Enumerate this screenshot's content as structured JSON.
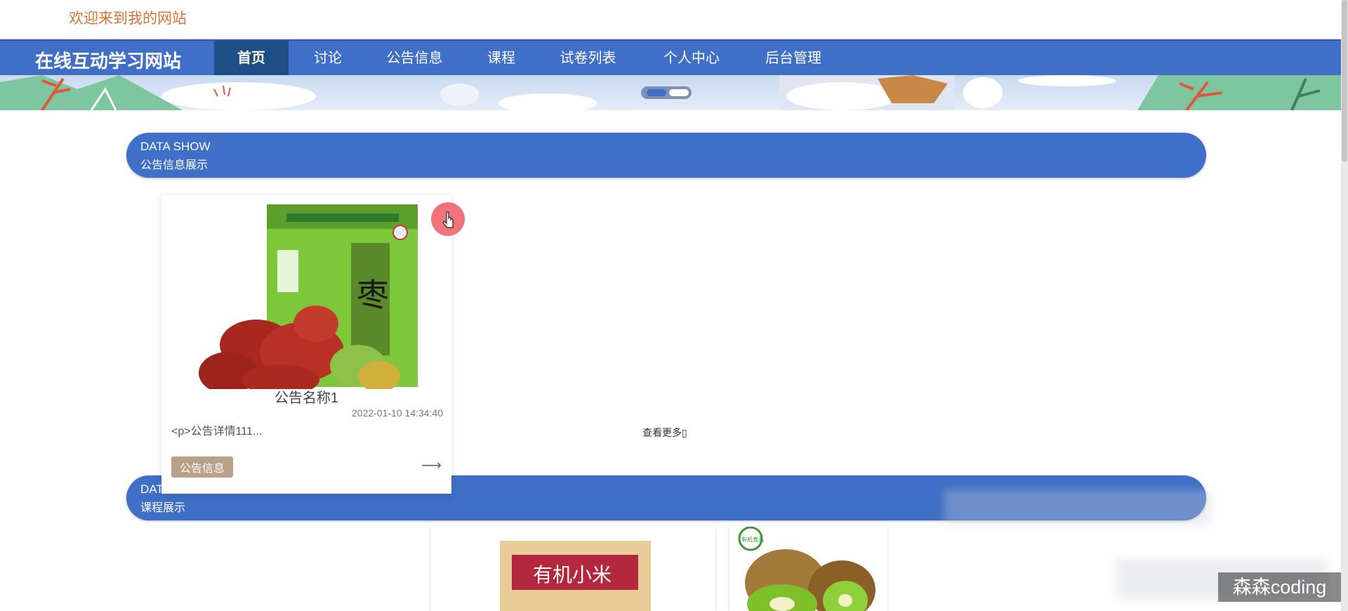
{
  "header": {
    "welcome": "欢迎来到我的网站"
  },
  "nav": {
    "site_title": "在线互动学习网站",
    "items": [
      {
        "label": "首页"
      },
      {
        "label": "讨论"
      },
      {
        "label": "公告信息"
      },
      {
        "label": "课程"
      },
      {
        "label": "试卷列表"
      },
      {
        "label": "个人中心"
      },
      {
        "label": "后台管理"
      }
    ],
    "active_index": 0
  },
  "banner": {
    "slide_count": 2,
    "active_slide": 1
  },
  "sections": [
    {
      "en": "DATA SHOW",
      "cn": "公告信息展示"
    },
    {
      "en": "DATA SHOW",
      "cn": "课程展示"
    }
  ],
  "notice_card": {
    "title": "公告名称1",
    "date": "2022-01-10 14:34:40",
    "desc": "<p>公告详情111...",
    "tag": "公告信息",
    "arrow": "⟶",
    "image_label": "红枣"
  },
  "more_link": "查看更多▯",
  "courses": [
    {
      "image_text": "有机小米"
    },
    {
      "image_text": "有机食品"
    }
  ],
  "watermark": "森森coding",
  "colors": {
    "nav": "#3f6fc6",
    "nav_active": "#1d4e86",
    "welcome": "#d4753a",
    "tag": "#b8a089"
  }
}
